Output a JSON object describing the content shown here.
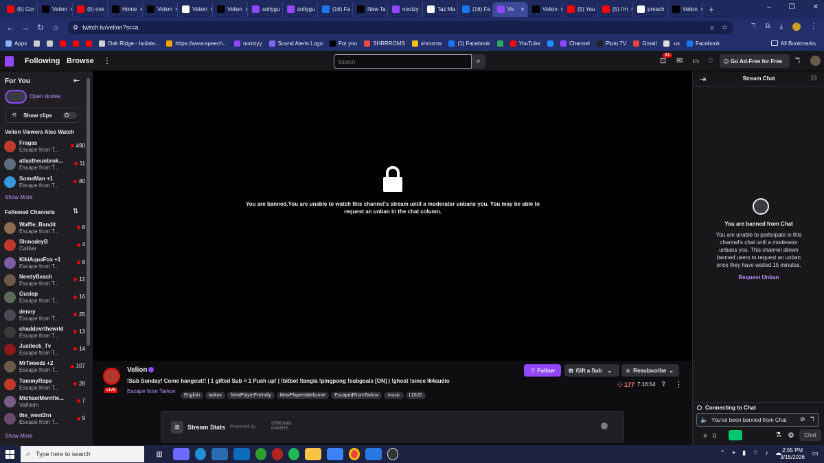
{
  "browser": {
    "tabs": [
      {
        "label": "(5) Cor",
        "icon": "youtube-icon",
        "color": "#ff0000"
      },
      {
        "label": "Velion",
        "icon": "x-icon",
        "color": "#000000"
      },
      {
        "label": "(5) ove",
        "icon": "youtube-icon",
        "color": "#ff0000"
      },
      {
        "label": "Home",
        "icon": "x-icon",
        "color": "#000000"
      },
      {
        "label": "Velion",
        "icon": "x-icon",
        "color": "#000000"
      },
      {
        "label": "Velion",
        "icon": "chrome-icon",
        "color": "#ffffff"
      },
      {
        "label": "Velion",
        "icon": "x-icon",
        "color": "#000000"
      },
      {
        "label": "soltygu",
        "icon": "twitch-icon",
        "color": "#9146ff"
      },
      {
        "label": "soltygu",
        "icon": "twitch-icon",
        "color": "#9146ff"
      },
      {
        "label": "(16) Fa",
        "icon": "facebook-icon",
        "color": "#1877f2"
      },
      {
        "label": "New Ta",
        "icon": "x-icon",
        "color": "#000000"
      },
      {
        "label": "nootzy",
        "icon": "twitch-icon",
        "color": "#9146ff"
      },
      {
        "label": "Taz Ma",
        "icon": "chrome-icon",
        "color": "#ffffff"
      },
      {
        "label": "(16) Fa",
        "icon": "facebook-icon",
        "color": "#1877f2"
      },
      {
        "label": "Ve",
        "icon": "twitch-icon",
        "color": "#9146ff",
        "active": true
      },
      {
        "label": "Velion",
        "icon": "x-icon",
        "color": "#000000"
      },
      {
        "label": "(5) You",
        "icon": "youtube-icon",
        "color": "#ff0000"
      },
      {
        "label": "(5) I'm",
        "icon": "youtube-icon",
        "color": "#ff0000"
      },
      {
        "label": "preach",
        "icon": "chrome-icon",
        "color": "#ffffff"
      },
      {
        "label": "Velion",
        "icon": "x-icon",
        "color": "#000000"
      }
    ],
    "new_tab": "+",
    "url": "twitch.tv/velion?sr=a",
    "bookmarks": [
      {
        "label": "Apps",
        "color": "#8ab4f8"
      },
      {
        "label": "",
        "color": "#cccccc"
      },
      {
        "label": "",
        "color": "#cccccc"
      },
      {
        "label": "",
        "color": "#ff0000"
      },
      {
        "label": "",
        "color": "#ff0000"
      },
      {
        "label": "",
        "color": "#ff0000"
      },
      {
        "label": "Oak Ridge - Isolate...",
        "color": "#d0d0d0"
      },
      {
        "label": "https://www.speech...",
        "color": "#ffa000"
      },
      {
        "label": "nootzyy",
        "color": "#9146ff"
      },
      {
        "label": "Sound Alerts Logo",
        "color": "#7b68ee"
      },
      {
        "label": "For you",
        "color": "#000000"
      },
      {
        "label": "SHRRROMS",
        "color": "#e74c3c"
      },
      {
        "label": "shrooms",
        "color": "#f1c40f"
      },
      {
        "label": "(1) Facebook",
        "color": "#1877f2"
      },
      {
        "label": "",
        "color": "#27ae60"
      },
      {
        "label": "YouTube",
        "color": "#ff0000"
      },
      {
        "label": "",
        "color": "#1e90ff"
      },
      {
        "label": "Channel",
        "color": "#9146ff"
      },
      {
        "label": "Pluto TV",
        "color": "#222222"
      },
      {
        "label": "Gmail",
        "color": "#ea4335"
      },
      {
        "label": ".us",
        "color": "#dddddd"
      },
      {
        "label": "Facebook",
        "color": "#1877f2"
      }
    ],
    "all_bookmarks": "All Bookmarks"
  },
  "twitch": {
    "nav": {
      "following": "Following",
      "browse": "Browse",
      "search_placeholder": "Search",
      "notif_count": "31",
      "ad_free": "Go Ad-Free for Free"
    },
    "sidebar": {
      "for_you": "For You",
      "open_stories": "Open stories",
      "show_clips": "Show clips",
      "also_watch_title": "Velion Viewers Also Watch",
      "also_watch": [
        {
          "name": "Fragas",
          "game": "Escape from T...",
          "viewers": "490",
          "color": "#c0392b"
        },
        {
          "name": "atlastheunbrok...",
          "game": "Escape from T...",
          "viewers": "11",
          "color": "#5d6d7e"
        },
        {
          "name": "SomeMan +1",
          "game": "Escape from T...",
          "viewers": "80",
          "color": "#3498db"
        }
      ],
      "show_more_1": "Show More",
      "followed_title": "Followed Channels",
      "followed": [
        {
          "name": "Waffle_Bandit",
          "game": "Escape from T...",
          "viewers": "8",
          "color": "#8e6e53"
        },
        {
          "name": "ShmodeyB",
          "game": "Caliber",
          "viewers": "4",
          "color": "#c0392b"
        },
        {
          "name": "KikiAquaFox +1",
          "game": "Escape from T...",
          "viewers": "9",
          "color": "#7d5ba6"
        },
        {
          "name": "NeedyBeach",
          "game": "Escape from T...",
          "viewers": "12",
          "color": "#6c5b4b"
        },
        {
          "name": "Guslap",
          "game": "Escape from T...",
          "viewers": "16",
          "color": "#5a6b5a"
        },
        {
          "name": "denny",
          "game": "Escape from T...",
          "viewers": "25",
          "color": "#4a4a55"
        },
        {
          "name": "chaddovrthewrld",
          "game": "Escape from T...",
          "viewers": "13",
          "color": "#3a3a3a"
        },
        {
          "name": "Justlock_Tv",
          "game": "Escape from T...",
          "viewers": "14",
          "color": "#8b1a1a"
        },
        {
          "name": "MrTweedz +2",
          "game": "Escape from T...",
          "viewers": "107",
          "color": "#6b5b4b"
        },
        {
          "name": "TommyReps",
          "game": "Escape from T...",
          "viewers": "28",
          "color": "#c0392b"
        },
        {
          "name": "MichaelMerrifie...",
          "game": "Valheim",
          "viewers": "7",
          "color": "#7a5c8a"
        },
        {
          "name": "the_west3rn",
          "game": "Escape from T...",
          "viewers": "9",
          "color": "#6a4a6a"
        }
      ],
      "show_more_2": "Show More"
    },
    "player": {
      "ban_message": "You are banned.You are unable to watch this channel's stream until a moderator unbans you. You may be able to request an unban in the chat column."
    },
    "channel": {
      "name": "Velion",
      "live": "LIVE",
      "title": "!Sub Sunday! Come hangout!! | 1 gifted Sub = 1 Push up! | !bitbot !tangia !pingpong !subgoals [ON] | !ghost !since l64audio",
      "game": "Escape from Tarkov",
      "tags": [
        "English",
        "tarkov",
        "NewPlayerFriendly",
        "NewPlayersWelcome",
        "EscapedFromTarkov",
        "music",
        "LOUD"
      ],
      "follow": "Follow",
      "gift": "Gift a Sub",
      "resub": "Resubscribe",
      "viewers": "177",
      "uptime": "7:16:54"
    },
    "stream_stats": {
      "label": "Stream Stats",
      "powered_by": "Powered by",
      "brand": "STREAMS CHARTS"
    },
    "chat": {
      "title": "Stream Chat",
      "banned_title": "You are banned from Chat",
      "banned_body": "You are unable to participate in this channel's chat until a moderator unbans you. This channel allows banned users to request an unban once they have waited 15 minutes.",
      "request_unban": "Request Unban",
      "connecting": "Connecting to Chat",
      "input_placeholder": "You've been banned from Chat",
      "points": "0",
      "send": "Chat"
    }
  },
  "taskbar": {
    "search_placeholder": "Type here to search",
    "time": "2:55 PM",
    "date": "3/15/2026"
  }
}
